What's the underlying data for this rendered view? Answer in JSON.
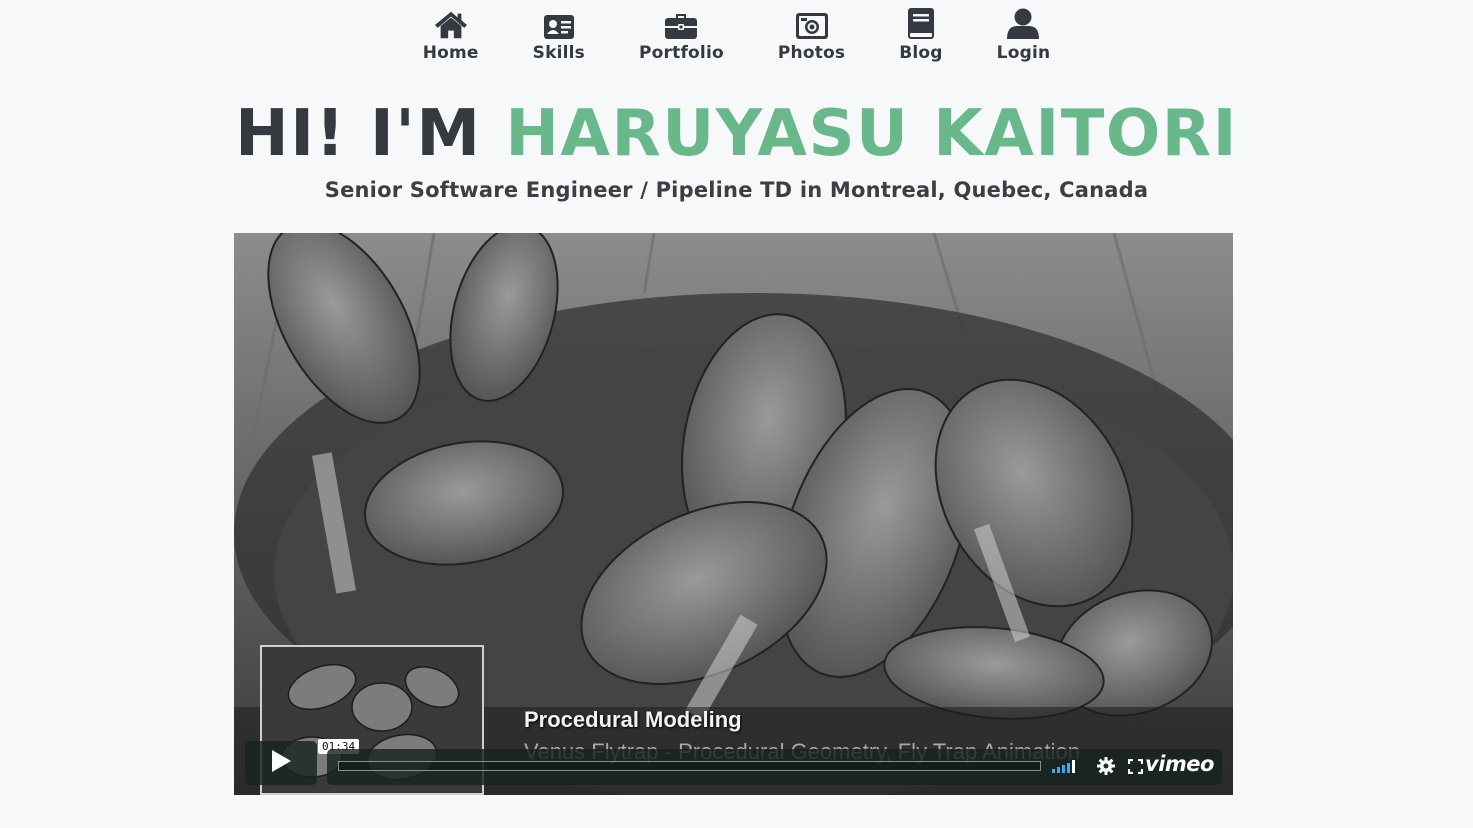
{
  "nav": {
    "items": [
      {
        "label": "Home",
        "icon": "home-icon"
      },
      {
        "label": "Skills",
        "icon": "id-card-icon"
      },
      {
        "label": "Portfolio",
        "icon": "briefcase-icon"
      },
      {
        "label": "Photos",
        "icon": "camera-icon"
      },
      {
        "label": "Blog",
        "icon": "book-icon"
      },
      {
        "label": "Login",
        "icon": "user-icon"
      }
    ]
  },
  "hero": {
    "greeting": "HI! I'M",
    "name": "HARUYASU KAITORI",
    "subtitle": "Senior Software Engineer / Pipeline TD in Montreal, Quebec, Canada"
  },
  "video": {
    "title_card": "Procedural Modeling",
    "subtitle_card": "Venus Flytrap - Procedural Geometry, Fly Trap Animation",
    "time": "01:34",
    "provider": "vimeo"
  },
  "colors": {
    "accent": "#68b88c",
    "text": "#343a40",
    "player_bg": "#172322"
  }
}
